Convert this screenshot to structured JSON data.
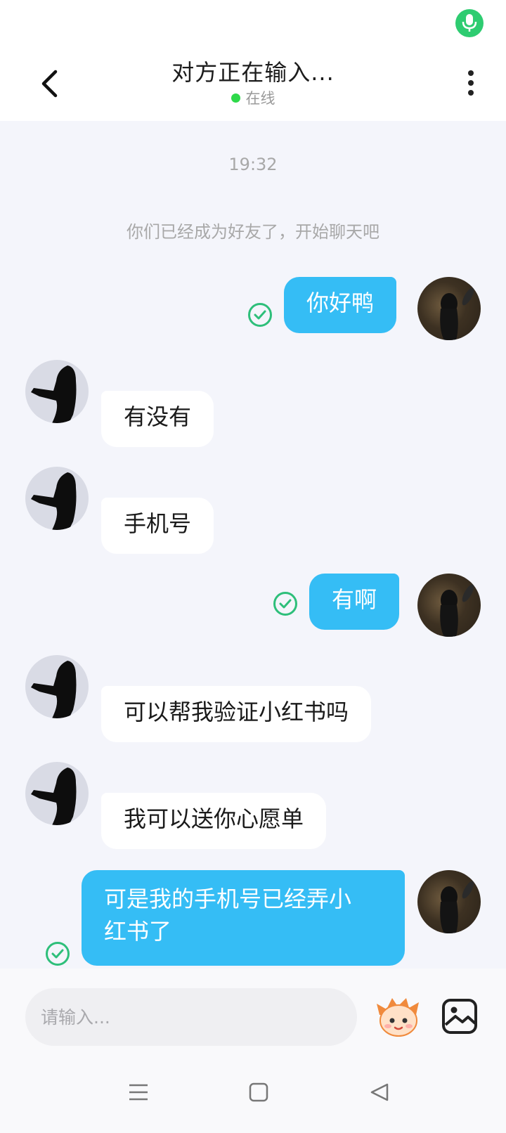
{
  "header": {
    "title": "对方正在输入...",
    "presence": "在线"
  },
  "chat": {
    "timestamp": "19:32",
    "system_message": "你们已经成为好友了，开始聊天吧",
    "messages": [
      {
        "from": "me",
        "text": "你好鸭",
        "status": "delivered"
      },
      {
        "from": "them",
        "text": "有没有"
      },
      {
        "from": "them",
        "text": "手机号"
      },
      {
        "from": "me",
        "text": "有啊",
        "status": "delivered"
      },
      {
        "from": "them",
        "text": "可以帮我验证小红书吗"
      },
      {
        "from": "them",
        "text": "我可以送你心愿单"
      },
      {
        "from": "me",
        "text": "可是我的手机号已经弄小\n红书了",
        "status": "delivered"
      }
    ]
  },
  "input": {
    "placeholder": "请输入..."
  },
  "icons": {
    "mic": "mic-icon",
    "back": "chevron-left-icon",
    "more": "more-vertical-icon",
    "check": "check-circle-icon",
    "emoji": "emoji-sticker-icon",
    "image": "image-icon",
    "nav_menu": "menu-icon",
    "nav_home": "square-icon",
    "nav_back": "triangle-back-icon"
  },
  "colors": {
    "my_bubble": "#35bdf5",
    "their_bubble": "#ffffff",
    "online": "#2ed94a",
    "check": "#2ebf7a",
    "mic": "#2ecc71"
  }
}
